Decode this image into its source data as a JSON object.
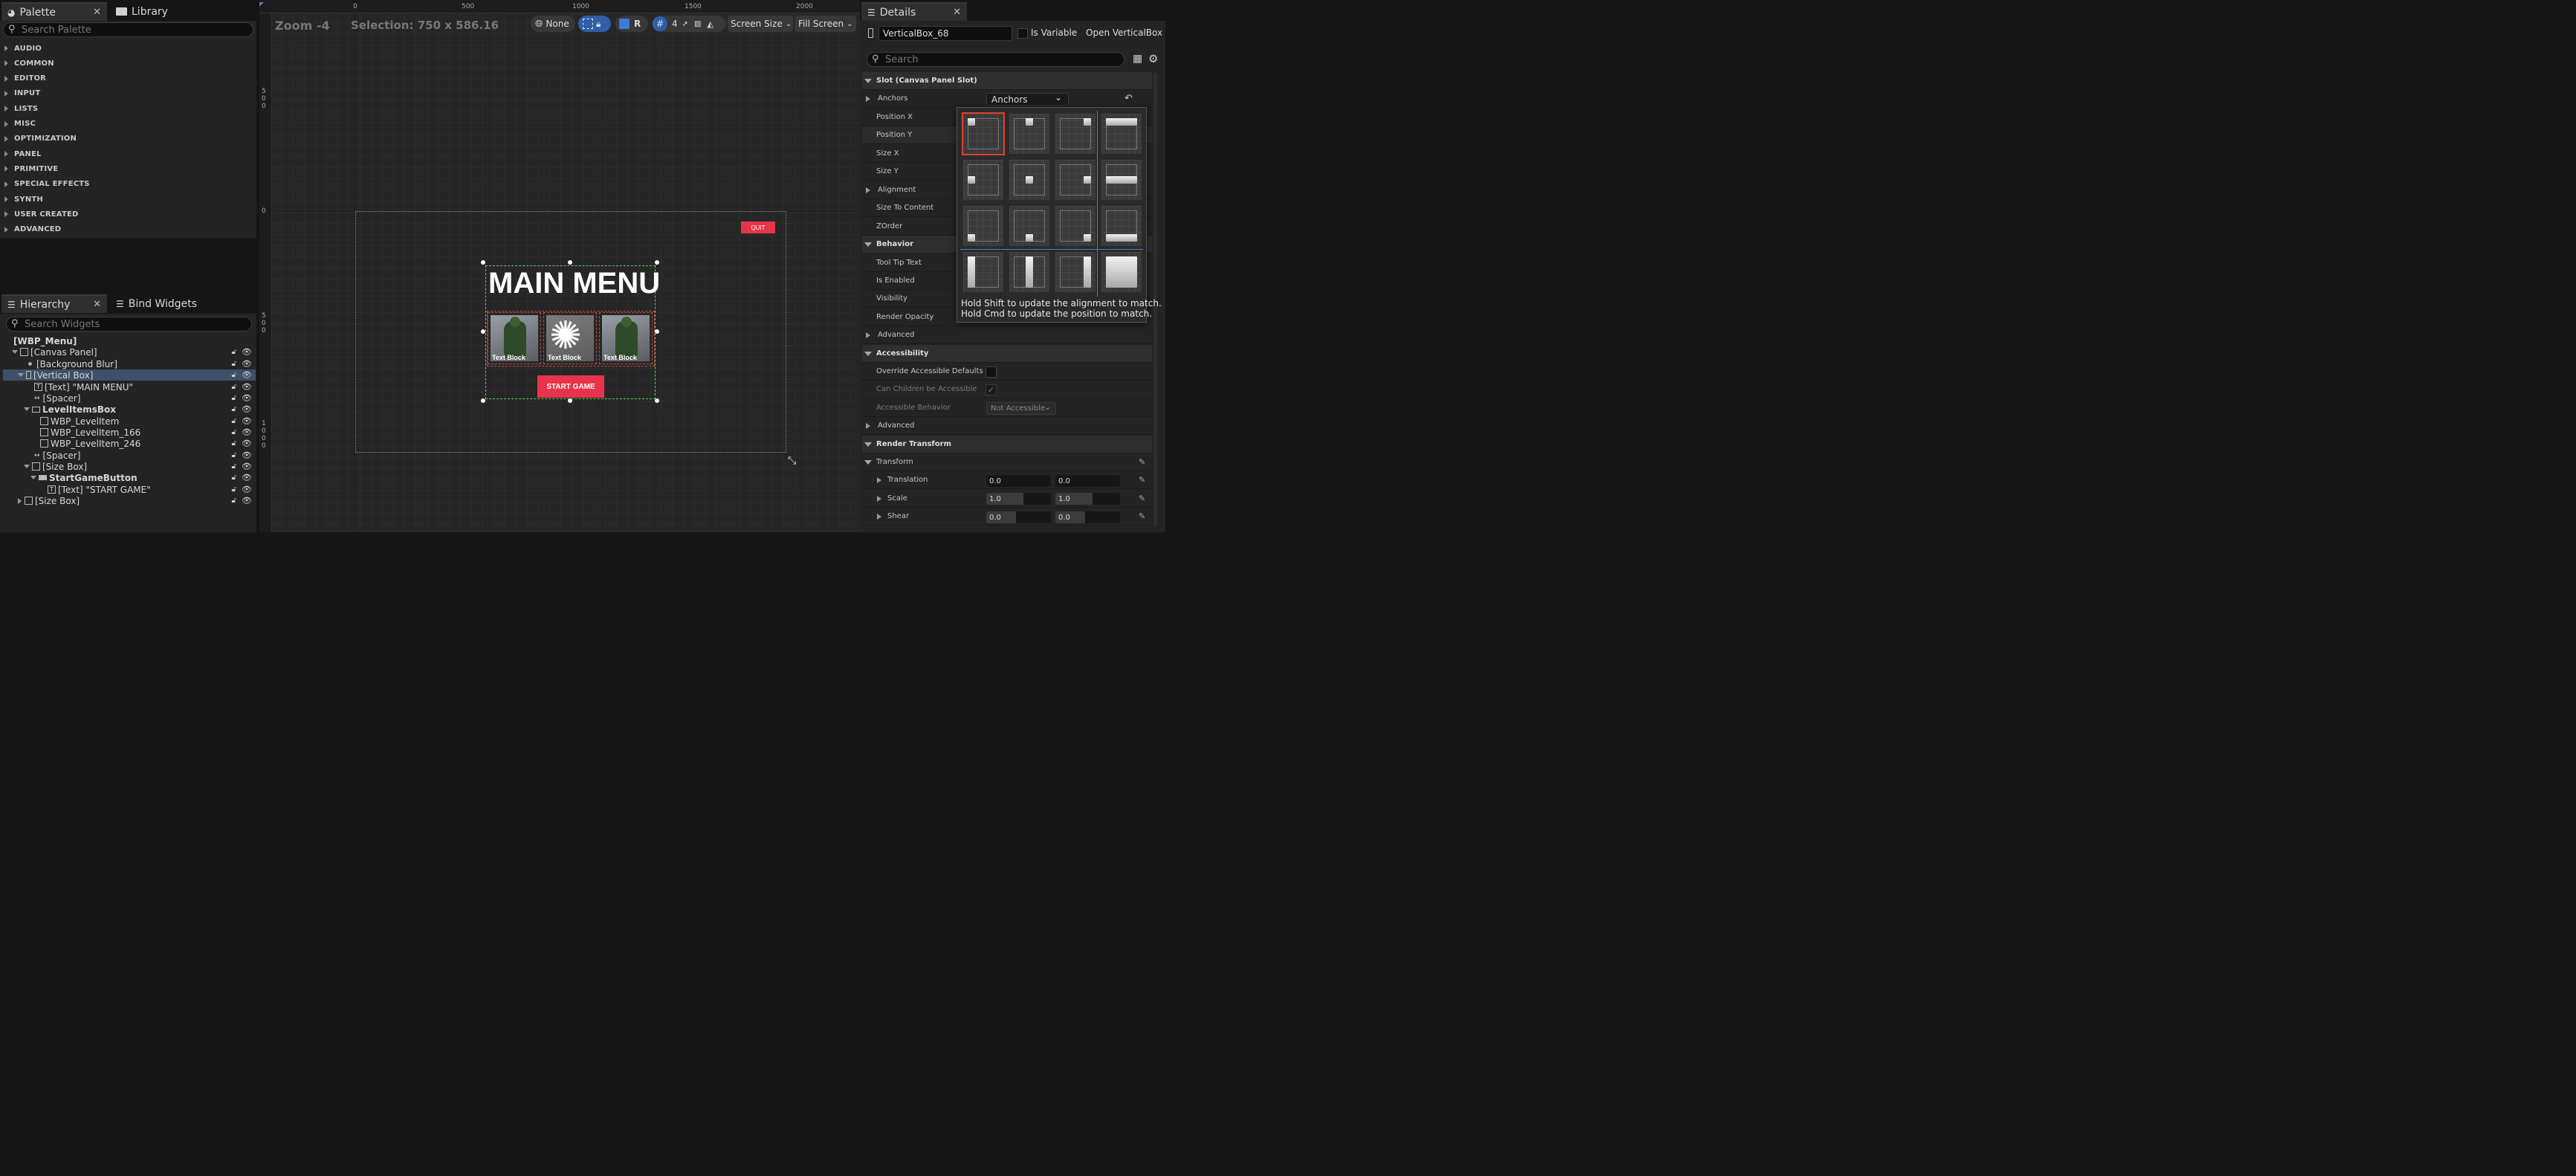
{
  "palette": {
    "tab_label": "Palette",
    "library_tab_label": "Library",
    "search_placeholder": "Search Palette",
    "categories": [
      "AUDIO",
      "COMMON",
      "EDITOR",
      "INPUT",
      "LISTS",
      "MISC",
      "OPTIMIZATION",
      "PANEL",
      "PRIMITIVE",
      "SPECIAL EFFECTS",
      "SYNTH",
      "USER CREATED",
      "ADVANCED"
    ]
  },
  "hierarchy": {
    "tab_label": "Hierarchy",
    "bind_tab_label": "Bind Widgets",
    "search_placeholder": "Search Widgets",
    "items": [
      {
        "label": "[WBP_Menu]"
      },
      {
        "label": "[Canvas Panel]"
      },
      {
        "label": "[Background Blur]"
      },
      {
        "label": "[Vertical Box]"
      },
      {
        "label": "[Text] \"MAIN MENU\""
      },
      {
        "label": "[Spacer]"
      },
      {
        "label": "LevelItemsBox"
      },
      {
        "label": "WBP_LevelItem"
      },
      {
        "label": "WBP_LevelItem_166"
      },
      {
        "label": "WBP_LevelItem_246"
      },
      {
        "label": "[Spacer]"
      },
      {
        "label": "[Size Box]"
      },
      {
        "label": "StartGameButton"
      },
      {
        "label": "[Text] \"START GAME\""
      },
      {
        "label": "[Size Box]"
      }
    ]
  },
  "viewport": {
    "zoom": "Zoom -4",
    "selection": "Selection: 750 x 586.16",
    "ruler_top": [
      "0",
      "500",
      "1000",
      "1500",
      "2000"
    ],
    "ruler_left": [
      "5\n0\n0",
      "0",
      "5\n0\n0",
      "1\n0\n0\n0"
    ],
    "toolbar": {
      "localize_label": "None",
      "r_label": "R",
      "grid_label": "4",
      "screen_size_label": "Screen Size",
      "fill_screen_label": "Fill Screen"
    },
    "design": {
      "quit_label": "QUIT",
      "title": "MAIN MENU",
      "level_items": [
        "Text Block",
        "Text Block",
        "Text Block"
      ],
      "start_label": "START GAME"
    }
  },
  "details": {
    "tab_label": "Details",
    "name_value": "VerticalBox_68",
    "is_variable_label": "Is Variable",
    "open_label": "Open VerticalBox",
    "search_placeholder": "Search",
    "slot_section": "Slot (Canvas Panel Slot)",
    "anchors_label": "Anchors",
    "anchors_value": "Anchors",
    "position_x": "Position X",
    "position_y": "Position Y",
    "size_x": "Size X",
    "size_y": "Size Y",
    "alignment": "Alignment",
    "size_to_content": "Size To Content",
    "zorder": "ZOrder",
    "behavior_section": "Behavior",
    "tooltip_text": "Tool Tip Text",
    "is_enabled": "Is Enabled",
    "visibility": "Visibility",
    "render_opacity": "Render Opacity",
    "advanced": "Advanced",
    "accessibility_section": "Accessibility",
    "override_accessible": "Override Accessible Defaults",
    "can_children": "Can Children be Accessible",
    "accessible_behavior": "Accessible Behavior",
    "accessible_behavior_value": "Not Accessible",
    "advanced2": "Advanced",
    "render_transform_section": "Render Transform",
    "transform": "Transform",
    "translation": "Translation",
    "translation_x": "0.0",
    "translation_y": "0.0",
    "scale": "Scale",
    "scale_x": "1.0",
    "scale_y": "1.0",
    "shear": "Shear",
    "shear_x": "0.0",
    "shear_y": "0.0",
    "anchors_hint_1": "Hold Shift to update the alignment to match.",
    "anchors_hint_2": "Hold Cmd to update the position to match."
  },
  "colors": {
    "accent_red": "#e8344a",
    "selection_blue": "#3d5068",
    "toolbar_blue": "#2e5fa8"
  }
}
